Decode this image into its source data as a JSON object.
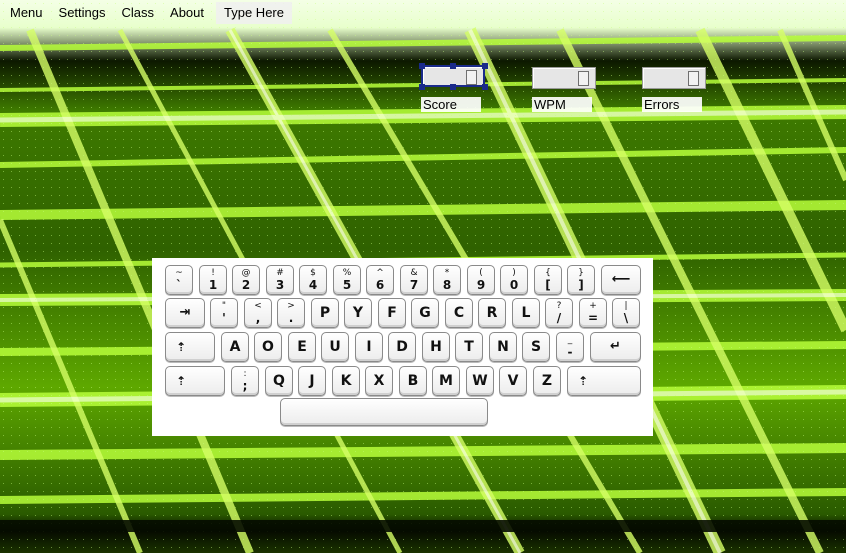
{
  "menubar": {
    "items": [
      {
        "label": "Menu"
      },
      {
        "label": "Settings"
      },
      {
        "label": "Class"
      },
      {
        "label": "About"
      }
    ],
    "type_here_label": "Type Here"
  },
  "stats": {
    "score_label": "Score",
    "wpm_label": "WPM",
    "errors_label": "Errors"
  },
  "keyboard": {
    "row1": [
      {
        "top": "~",
        "bot": "`"
      },
      {
        "top": "!",
        "bot": "1"
      },
      {
        "top": "@",
        "bot": "2"
      },
      {
        "top": "#",
        "bot": "3"
      },
      {
        "top": "$",
        "bot": "4"
      },
      {
        "top": "%",
        "bot": "5"
      },
      {
        "top": "^",
        "bot": "6"
      },
      {
        "top": "&",
        "bot": "7"
      },
      {
        "top": "*",
        "bot": "8"
      },
      {
        "top": "(",
        "bot": "9"
      },
      {
        "top": ")",
        "bot": "0"
      },
      {
        "top": "{",
        "bot": "["
      },
      {
        "top": "}",
        "bot": "]"
      }
    ],
    "backspace_glyph": "⟵",
    "tab_glyph": "⇥",
    "row2": [
      {
        "top": "\"",
        "bot": "'"
      },
      {
        "top": "<",
        "bot": ","
      },
      {
        "top": ">",
        "bot": "."
      },
      {
        "main": "P"
      },
      {
        "main": "Y"
      },
      {
        "main": "F"
      },
      {
        "main": "G"
      },
      {
        "main": "C"
      },
      {
        "main": "R"
      },
      {
        "main": "L"
      },
      {
        "top": "?",
        "bot": "/"
      },
      {
        "top": "+",
        "bot": "="
      },
      {
        "top": "|",
        "bot": "\\"
      }
    ],
    "caps_glyph": "⇡",
    "row3": [
      {
        "main": "A"
      },
      {
        "main": "O"
      },
      {
        "main": "E"
      },
      {
        "main": "U"
      },
      {
        "main": "I"
      },
      {
        "main": "D"
      },
      {
        "main": "H"
      },
      {
        "main": "T"
      },
      {
        "main": "N"
      },
      {
        "main": "S"
      },
      {
        "top": "_",
        "bot": "-"
      }
    ],
    "enter_glyph": "↵",
    "shift_glyph": "⇡",
    "row4": [
      {
        "top": ":",
        "bot": ";"
      },
      {
        "main": "Q"
      },
      {
        "main": "J"
      },
      {
        "main": "K"
      },
      {
        "main": "X"
      },
      {
        "main": "B"
      },
      {
        "main": "M"
      },
      {
        "main": "W"
      },
      {
        "main": "V"
      },
      {
        "main": "Z"
      }
    ],
    "space_label": ""
  },
  "colors": {
    "accent_green": "#9cff1a",
    "selection_blue": "#1a2a8a"
  }
}
